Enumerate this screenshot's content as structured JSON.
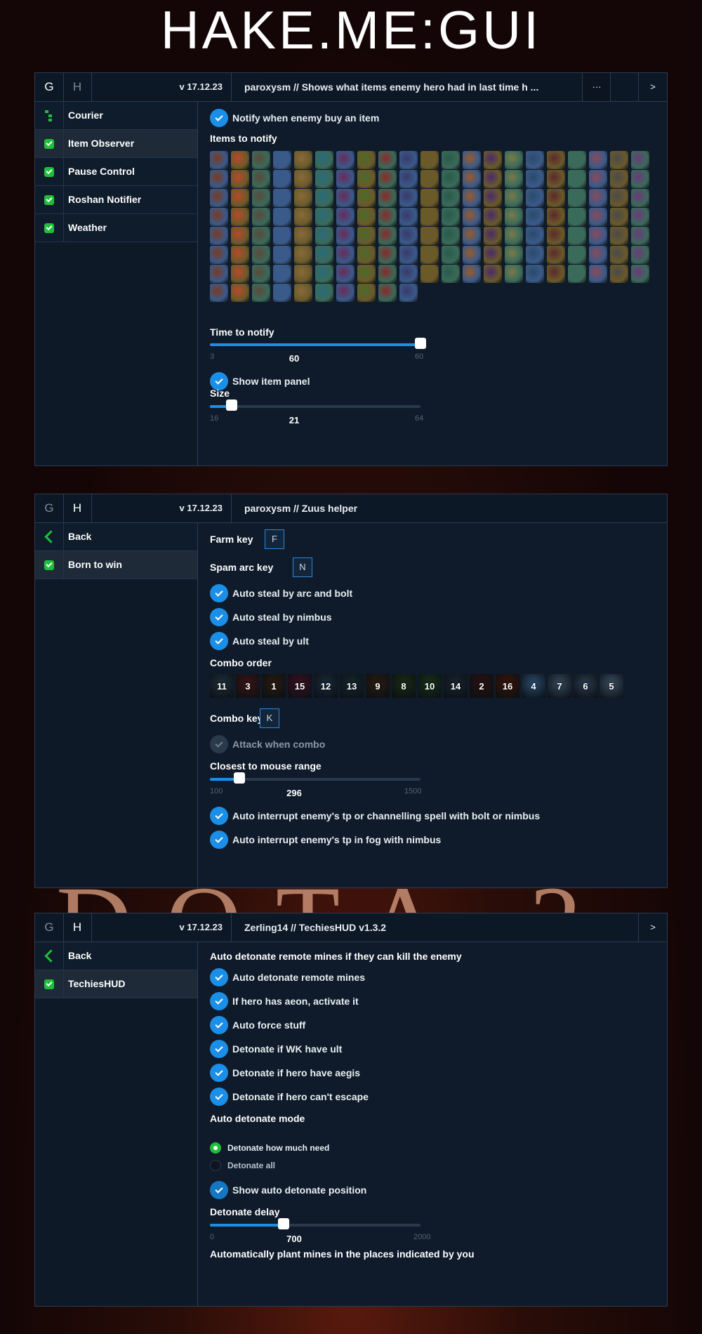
{
  "title": "HAKE.ME:GUI",
  "bg_logo": {
    "text": "DOTA 2"
  },
  "panel1": {
    "tab_g": "G",
    "tab_h": "H",
    "version": "v 17.12.23",
    "description": "paroxysm // Shows what items enemy hero had in last time h ...",
    "more_label": "···",
    "next_label": ">",
    "sidebar": [
      {
        "label": "Courier",
        "icon": "tree-icon"
      },
      {
        "label": "Item Observer",
        "icon": "checkbox-icon",
        "selected": true
      },
      {
        "label": "Pause Control",
        "icon": "checkbox-icon"
      },
      {
        "label": "Roshan Notifier",
        "icon": "checkbox-icon"
      },
      {
        "label": "Weather",
        "icon": "checkbox-icon"
      }
    ],
    "notify_buy": "Notify when enemy buy an item",
    "items_label": "Items to notify",
    "time_label": "Time to notify",
    "time_slider": {
      "min": "3",
      "max": "60",
      "value": "60",
      "fraction": 1.0
    },
    "show_panel": "Show item panel",
    "size_label": "Size",
    "size_slider": {
      "min": "16",
      "max": "64",
      "value": "21",
      "fraction": 0.104
    },
    "item_colors": [
      "#7a3a22",
      "#b8492a",
      "#5a4a3c",
      "#3a5a8a",
      "#8a6a3a",
      "#2a6a7a",
      "#6a2a5a",
      "#4a6a2a",
      "#8a2a2a",
      "#3a3a6a",
      "#6a5a2a",
      "#2a5a4a",
      "#9a5a2a",
      "#4a2a6a",
      "#7a7a4a",
      "#2a4a6a",
      "#5a2a2a",
      "#3a6a5a",
      "#8a4a5a",
      "#4a4a4a",
      "#6a3a7a"
    ]
  },
  "panel2": {
    "tab_g": "G",
    "tab_h": "H",
    "version": "v 17.12.23",
    "description": "paroxysm // Zuus helper",
    "sidebar": [
      {
        "label": "Back",
        "icon": "back-icon"
      },
      {
        "label": "Born to win",
        "icon": "checkbox-icon",
        "selected": true
      }
    ],
    "farm_key_label": "Farm key",
    "farm_key": "F",
    "spam_key_label": "Spam arc key",
    "spam_key": "N",
    "steal_arc": "Auto steal by arc and bolt",
    "steal_nimbus": "Auto steal by nimbus",
    "steal_ult": "Auto steal by ult",
    "combo_order_label": "Combo order",
    "combo_order": [
      "11",
      "3",
      "1",
      "15",
      "12",
      "13",
      "9",
      "8",
      "10",
      "14",
      "2",
      "16",
      "4",
      "7",
      "6",
      "5"
    ],
    "combo_colors": [
      "#1f2f3a",
      "#3a1414",
      "#2a1a10",
      "#3a1020",
      "#1a2a3a",
      "#14282e",
      "#2a1a12",
      "#1a2a14",
      "#183018",
      "#1a2430",
      "#2a1010",
      "#3a1408",
      "#2a4a6a",
      "#34485a",
      "#2a3a4c",
      "#3a4c60"
    ],
    "combo_key_label": "Combo key",
    "combo_key": "K",
    "attack_combo": "Attack when combo",
    "closest_label": "Closest to mouse range",
    "closest_slider": {
      "min": "100",
      "max": "1500",
      "value": "296",
      "fraction": 0.14
    },
    "interrupt_tp": "Auto interrupt enemy's tp or channelling spell with bolt or nimbus",
    "interrupt_fog": "Auto interrupt enemy's tp in fog with nimbus"
  },
  "panel3": {
    "tab_g": "G",
    "tab_h": "H",
    "version": "v 17.12.23",
    "description": "Zerling14 // TechiesHUD v1.3.2",
    "next_label": ">",
    "sidebar": [
      {
        "label": "Back",
        "icon": "back-icon"
      },
      {
        "label": "TechiesHUD",
        "icon": "checkbox-icon",
        "selected": true
      }
    ],
    "header_text": "Auto detonate remote mines if they can kill the enemy",
    "auto_detonate": "Auto detonate remote mines",
    "aeon": "If hero has aeon, activate it",
    "force": "Auto force stuff",
    "wk_ult": "Detonate if WK have ult",
    "aegis": "Detonate if hero have aegis",
    "cant_escape": "Detonate if hero can't escape",
    "mode_label": "Auto detonate mode",
    "mode_options": [
      "Detonate how much need",
      "Detonate all"
    ],
    "show_position": "Show auto detonate position",
    "delay_label": "Detonate delay",
    "delay_slider": {
      "min": "0",
      "max": "2000",
      "value": "700",
      "fraction": 0.35
    },
    "plant_text": "Automatically plant mines in the places indicated by you"
  }
}
